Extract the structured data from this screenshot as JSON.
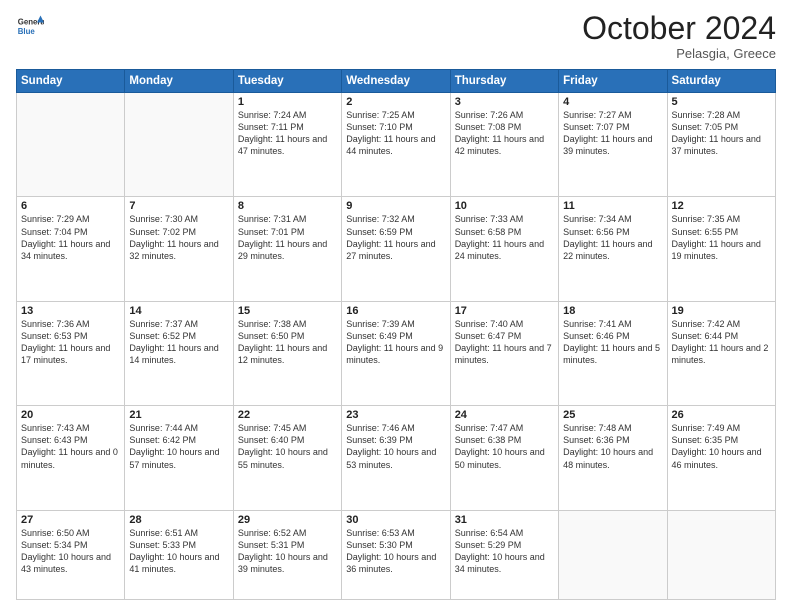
{
  "header": {
    "logo_line1": "General",
    "logo_line2": "Blue",
    "month": "October 2024",
    "location": "Pelasgia, Greece"
  },
  "weekdays": [
    "Sunday",
    "Monday",
    "Tuesday",
    "Wednesday",
    "Thursday",
    "Friday",
    "Saturday"
  ],
  "weeks": [
    [
      {
        "day": "",
        "info": ""
      },
      {
        "day": "",
        "info": ""
      },
      {
        "day": "1",
        "info": "Sunrise: 7:24 AM\nSunset: 7:11 PM\nDaylight: 11 hours and 47 minutes."
      },
      {
        "day": "2",
        "info": "Sunrise: 7:25 AM\nSunset: 7:10 PM\nDaylight: 11 hours and 44 minutes."
      },
      {
        "day": "3",
        "info": "Sunrise: 7:26 AM\nSunset: 7:08 PM\nDaylight: 11 hours and 42 minutes."
      },
      {
        "day": "4",
        "info": "Sunrise: 7:27 AM\nSunset: 7:07 PM\nDaylight: 11 hours and 39 minutes."
      },
      {
        "day": "5",
        "info": "Sunrise: 7:28 AM\nSunset: 7:05 PM\nDaylight: 11 hours and 37 minutes."
      }
    ],
    [
      {
        "day": "6",
        "info": "Sunrise: 7:29 AM\nSunset: 7:04 PM\nDaylight: 11 hours and 34 minutes."
      },
      {
        "day": "7",
        "info": "Sunrise: 7:30 AM\nSunset: 7:02 PM\nDaylight: 11 hours and 32 minutes."
      },
      {
        "day": "8",
        "info": "Sunrise: 7:31 AM\nSunset: 7:01 PM\nDaylight: 11 hours and 29 minutes."
      },
      {
        "day": "9",
        "info": "Sunrise: 7:32 AM\nSunset: 6:59 PM\nDaylight: 11 hours and 27 minutes."
      },
      {
        "day": "10",
        "info": "Sunrise: 7:33 AM\nSunset: 6:58 PM\nDaylight: 11 hours and 24 minutes."
      },
      {
        "day": "11",
        "info": "Sunrise: 7:34 AM\nSunset: 6:56 PM\nDaylight: 11 hours and 22 minutes."
      },
      {
        "day": "12",
        "info": "Sunrise: 7:35 AM\nSunset: 6:55 PM\nDaylight: 11 hours and 19 minutes."
      }
    ],
    [
      {
        "day": "13",
        "info": "Sunrise: 7:36 AM\nSunset: 6:53 PM\nDaylight: 11 hours and 17 minutes."
      },
      {
        "day": "14",
        "info": "Sunrise: 7:37 AM\nSunset: 6:52 PM\nDaylight: 11 hours and 14 minutes."
      },
      {
        "day": "15",
        "info": "Sunrise: 7:38 AM\nSunset: 6:50 PM\nDaylight: 11 hours and 12 minutes."
      },
      {
        "day": "16",
        "info": "Sunrise: 7:39 AM\nSunset: 6:49 PM\nDaylight: 11 hours and 9 minutes."
      },
      {
        "day": "17",
        "info": "Sunrise: 7:40 AM\nSunset: 6:47 PM\nDaylight: 11 hours and 7 minutes."
      },
      {
        "day": "18",
        "info": "Sunrise: 7:41 AM\nSunset: 6:46 PM\nDaylight: 11 hours and 5 minutes."
      },
      {
        "day": "19",
        "info": "Sunrise: 7:42 AM\nSunset: 6:44 PM\nDaylight: 11 hours and 2 minutes."
      }
    ],
    [
      {
        "day": "20",
        "info": "Sunrise: 7:43 AM\nSunset: 6:43 PM\nDaylight: 11 hours and 0 minutes."
      },
      {
        "day": "21",
        "info": "Sunrise: 7:44 AM\nSunset: 6:42 PM\nDaylight: 10 hours and 57 minutes."
      },
      {
        "day": "22",
        "info": "Sunrise: 7:45 AM\nSunset: 6:40 PM\nDaylight: 10 hours and 55 minutes."
      },
      {
        "day": "23",
        "info": "Sunrise: 7:46 AM\nSunset: 6:39 PM\nDaylight: 10 hours and 53 minutes."
      },
      {
        "day": "24",
        "info": "Sunrise: 7:47 AM\nSunset: 6:38 PM\nDaylight: 10 hours and 50 minutes."
      },
      {
        "day": "25",
        "info": "Sunrise: 7:48 AM\nSunset: 6:36 PM\nDaylight: 10 hours and 48 minutes."
      },
      {
        "day": "26",
        "info": "Sunrise: 7:49 AM\nSunset: 6:35 PM\nDaylight: 10 hours and 46 minutes."
      }
    ],
    [
      {
        "day": "27",
        "info": "Sunrise: 6:50 AM\nSunset: 5:34 PM\nDaylight: 10 hours and 43 minutes."
      },
      {
        "day": "28",
        "info": "Sunrise: 6:51 AM\nSunset: 5:33 PM\nDaylight: 10 hours and 41 minutes."
      },
      {
        "day": "29",
        "info": "Sunrise: 6:52 AM\nSunset: 5:31 PM\nDaylight: 10 hours and 39 minutes."
      },
      {
        "day": "30",
        "info": "Sunrise: 6:53 AM\nSunset: 5:30 PM\nDaylight: 10 hours and 36 minutes."
      },
      {
        "day": "31",
        "info": "Sunrise: 6:54 AM\nSunset: 5:29 PM\nDaylight: 10 hours and 34 minutes."
      },
      {
        "day": "",
        "info": ""
      },
      {
        "day": "",
        "info": ""
      }
    ]
  ]
}
